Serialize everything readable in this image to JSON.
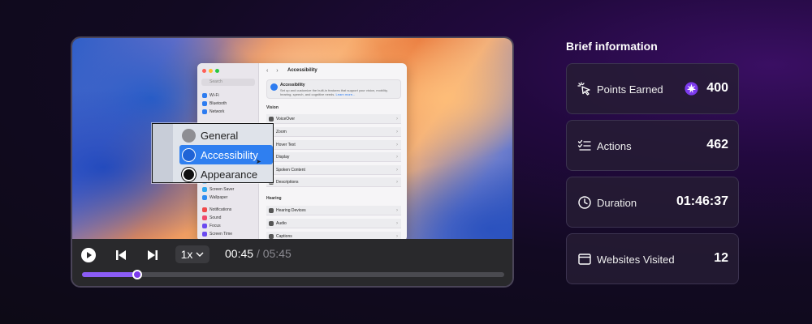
{
  "player": {
    "settings_window": {
      "search_placeholder": "Search",
      "sidebar_items_top": [
        "Wi-Fi",
        "Bluetooth",
        "Network"
      ],
      "sidebar_items_bottom": [
        "Desktop",
        "Screen Saver",
        "Wallpaper",
        "Notifications",
        "Sound",
        "Focus",
        "Screen Time"
      ],
      "title": "Accessibility",
      "intro_title": "Accessibility",
      "intro_desc": "Set up and customize the built-in features that support your vision, mobility, hearing, speech, and cognitive needs.",
      "intro_link": "Learn more...",
      "vision_section": "Vision",
      "vision_rows": [
        "VoiceOver",
        "Zoom",
        "Hover Text",
        "Display",
        "Spoken Content",
        "Descriptions"
      ],
      "hearing_section": "Hearing",
      "hearing_rows": [
        "Hearing Devices",
        "Audio",
        "Captions"
      ]
    },
    "zoom_overlay": {
      "items": [
        "General",
        "Accessibility",
        "Appearance"
      ],
      "selected": "Accessibility"
    },
    "controls": {
      "speed": "1x",
      "current_time": "00:45",
      "separator": "/",
      "total_time": "05:45",
      "progress_fraction": 0.13
    }
  },
  "info": {
    "title": "Brief information",
    "cards": [
      {
        "icon": "cursor-click-icon",
        "label": "Points Earned",
        "value": "400"
      },
      {
        "icon": "checklist-icon",
        "label": "Actions",
        "value": "462"
      },
      {
        "icon": "clock-icon",
        "label": "Duration",
        "value": "01:46:37"
      },
      {
        "icon": "browser-window-icon",
        "label": "Websites Visited",
        "value": "12"
      }
    ]
  },
  "colors": {
    "accent": "#7c3aed",
    "selection_blue": "#2f7ff0",
    "card_bg": "#261c34"
  }
}
